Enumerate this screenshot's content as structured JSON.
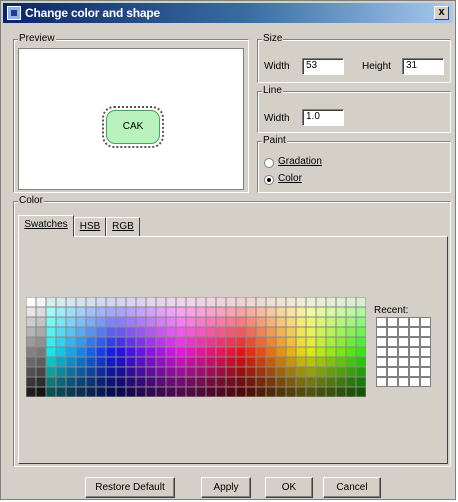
{
  "window": {
    "title": "Change color and shape",
    "close_label": "x"
  },
  "preview": {
    "legend": "Preview",
    "node_label": "CAK"
  },
  "size": {
    "legend": "Size",
    "width_label": "Width",
    "width_value": "53",
    "height_label": "Height",
    "height_value": "31"
  },
  "line": {
    "legend": "Line",
    "width_label": "Width",
    "width_value": "1.0"
  },
  "paint": {
    "legend": "Paint",
    "options": [
      {
        "label": "Gradation",
        "selected": false
      },
      {
        "label": "Color",
        "selected": true
      }
    ]
  },
  "color": {
    "legend": "Color",
    "tabs": [
      "Swatches",
      "HSB",
      "RGB"
    ],
    "active_tab": "Swatches",
    "recent_label": "Recent:"
  },
  "buttons": {
    "restore": "Restore Default",
    "apply": "Apply",
    "ok": "OK",
    "cancel": "Cancel"
  },
  "colors": {
    "title_start": "#0a246a",
    "title_end": "#a6caf0",
    "dialog_bg": "#d4d0c8",
    "node_fill": "#b9f2bd",
    "recent_cell": "#ffffff"
  }
}
